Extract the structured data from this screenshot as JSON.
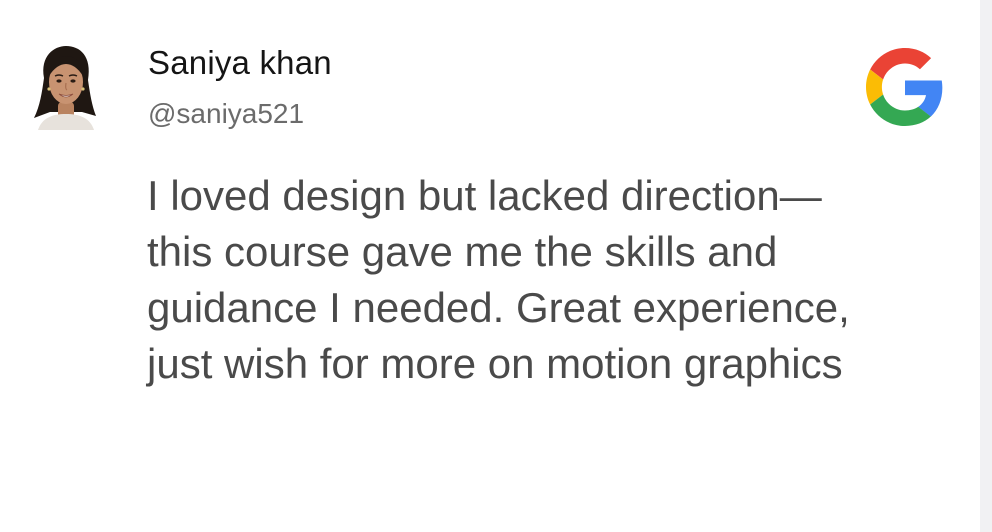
{
  "reviewer": {
    "name": "Saniya khan",
    "handle": "@saniya521"
  },
  "source": {
    "icon": "google-icon",
    "colors": {
      "blue": "#4285F4",
      "red": "#EA4335",
      "yellow": "#FBBC05",
      "green": "#34A853"
    }
  },
  "review": {
    "lines": [
      "I loved design but lacked direction—",
      "this course gave me the skills and",
      "guidance I needed. Great experience,",
      "just wish for more on motion graphics"
    ]
  },
  "colors": {
    "background": "#ffffff",
    "name_text": "#151515",
    "handle_text": "#6b6b6b",
    "body_text": "#4a4a4a"
  }
}
